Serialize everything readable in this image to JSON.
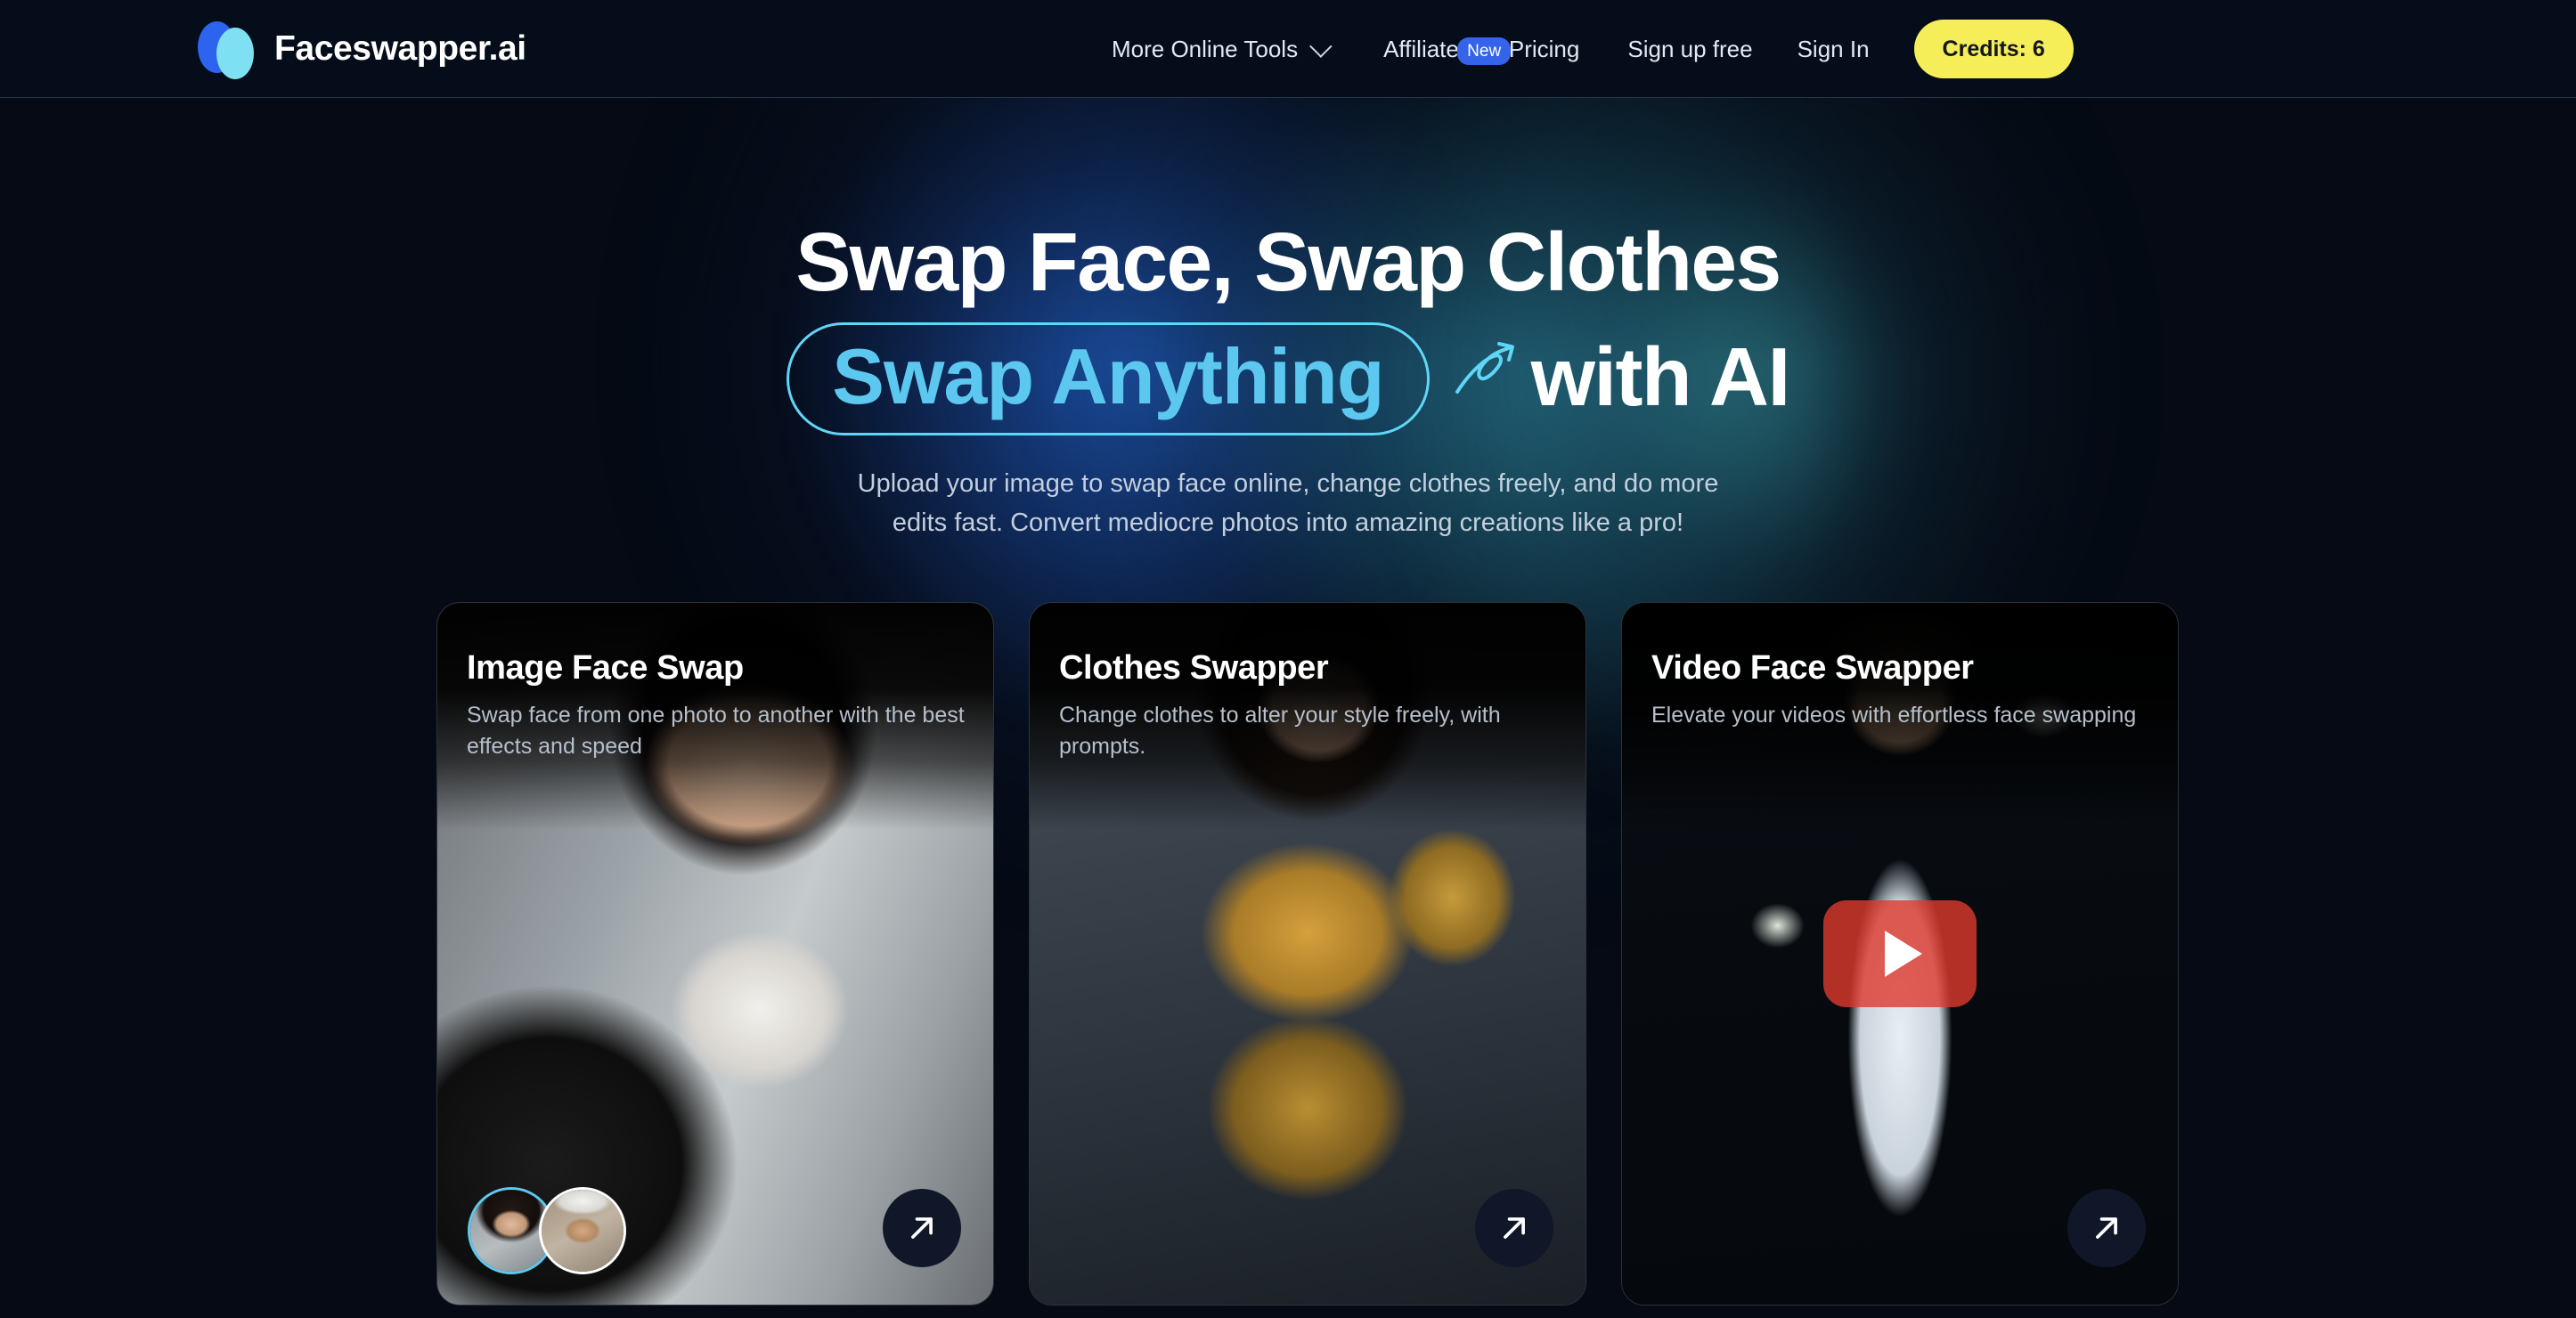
{
  "brand": {
    "name": "Faceswapper.ai",
    "logo_icon": "two-overlapping-ellipses-logo",
    "color_primary": "#2c63ef",
    "color_secondary": "#7ee0f2"
  },
  "nav": {
    "items": [
      {
        "label": "More Online Tools",
        "icon": "chevron-down-icon",
        "has_chevron": true
      },
      {
        "label": "Affiliate",
        "badge": "New"
      },
      {
        "label": "Pricing"
      },
      {
        "label": "Sign up free"
      },
      {
        "label": "Sign In"
      }
    ],
    "credits_button": {
      "label": "Credits: 6",
      "bg_color": "#f6ee59",
      "text_color": "#12161f"
    },
    "badge_color": "#3563e9"
  },
  "hero": {
    "headline_line1": "Swap Face, Swap Clothes",
    "pill_label": "Swap Anything",
    "pill_border_color": "#5fd6f5",
    "pill_text_color": "#5cc8ef",
    "arrow_icon": "curly-arrow-up-right-icon",
    "headline_tail": "with AI",
    "subtitle_line1": "Upload your image to swap face online, change clothes freely, and do more",
    "subtitle_line2": "edits fast. Convert mediocre photos into amazing creations like a pro!"
  },
  "cards": [
    {
      "title": "Image Face Swap",
      "description": "Swap face from one photo to another with the best effects and speed",
      "photo_alt": "smiling-woman-curly-hair-white-lace-top",
      "go_icon": "arrow-up-right-icon",
      "avatars": [
        {
          "alt": "avatar-woman-curly-hair",
          "selected": true,
          "ring_color": "#5ec8ee"
        },
        {
          "alt": "avatar-woman-white-hat",
          "selected": false,
          "ring_color": "#ffffff"
        }
      ]
    },
    {
      "title": "Clothes Swapper",
      "description": "Change clothes to alter your style freely, with prompts.",
      "photo_alt": "woman-in-golden-fantasy-armor-dark-city",
      "go_icon": "arrow-up-right-icon",
      "avatars": []
    },
    {
      "title": "Video Face Swapper",
      "description": "Elevate your videos with effortless face swapping",
      "photo_alt": "smiling-man-in-suit-with-flying-money",
      "go_icon": "arrow-up-right-icon",
      "play_button": {
        "icon": "youtube-play-icon",
        "color": "#de3a2d"
      },
      "avatars": []
    }
  ]
}
